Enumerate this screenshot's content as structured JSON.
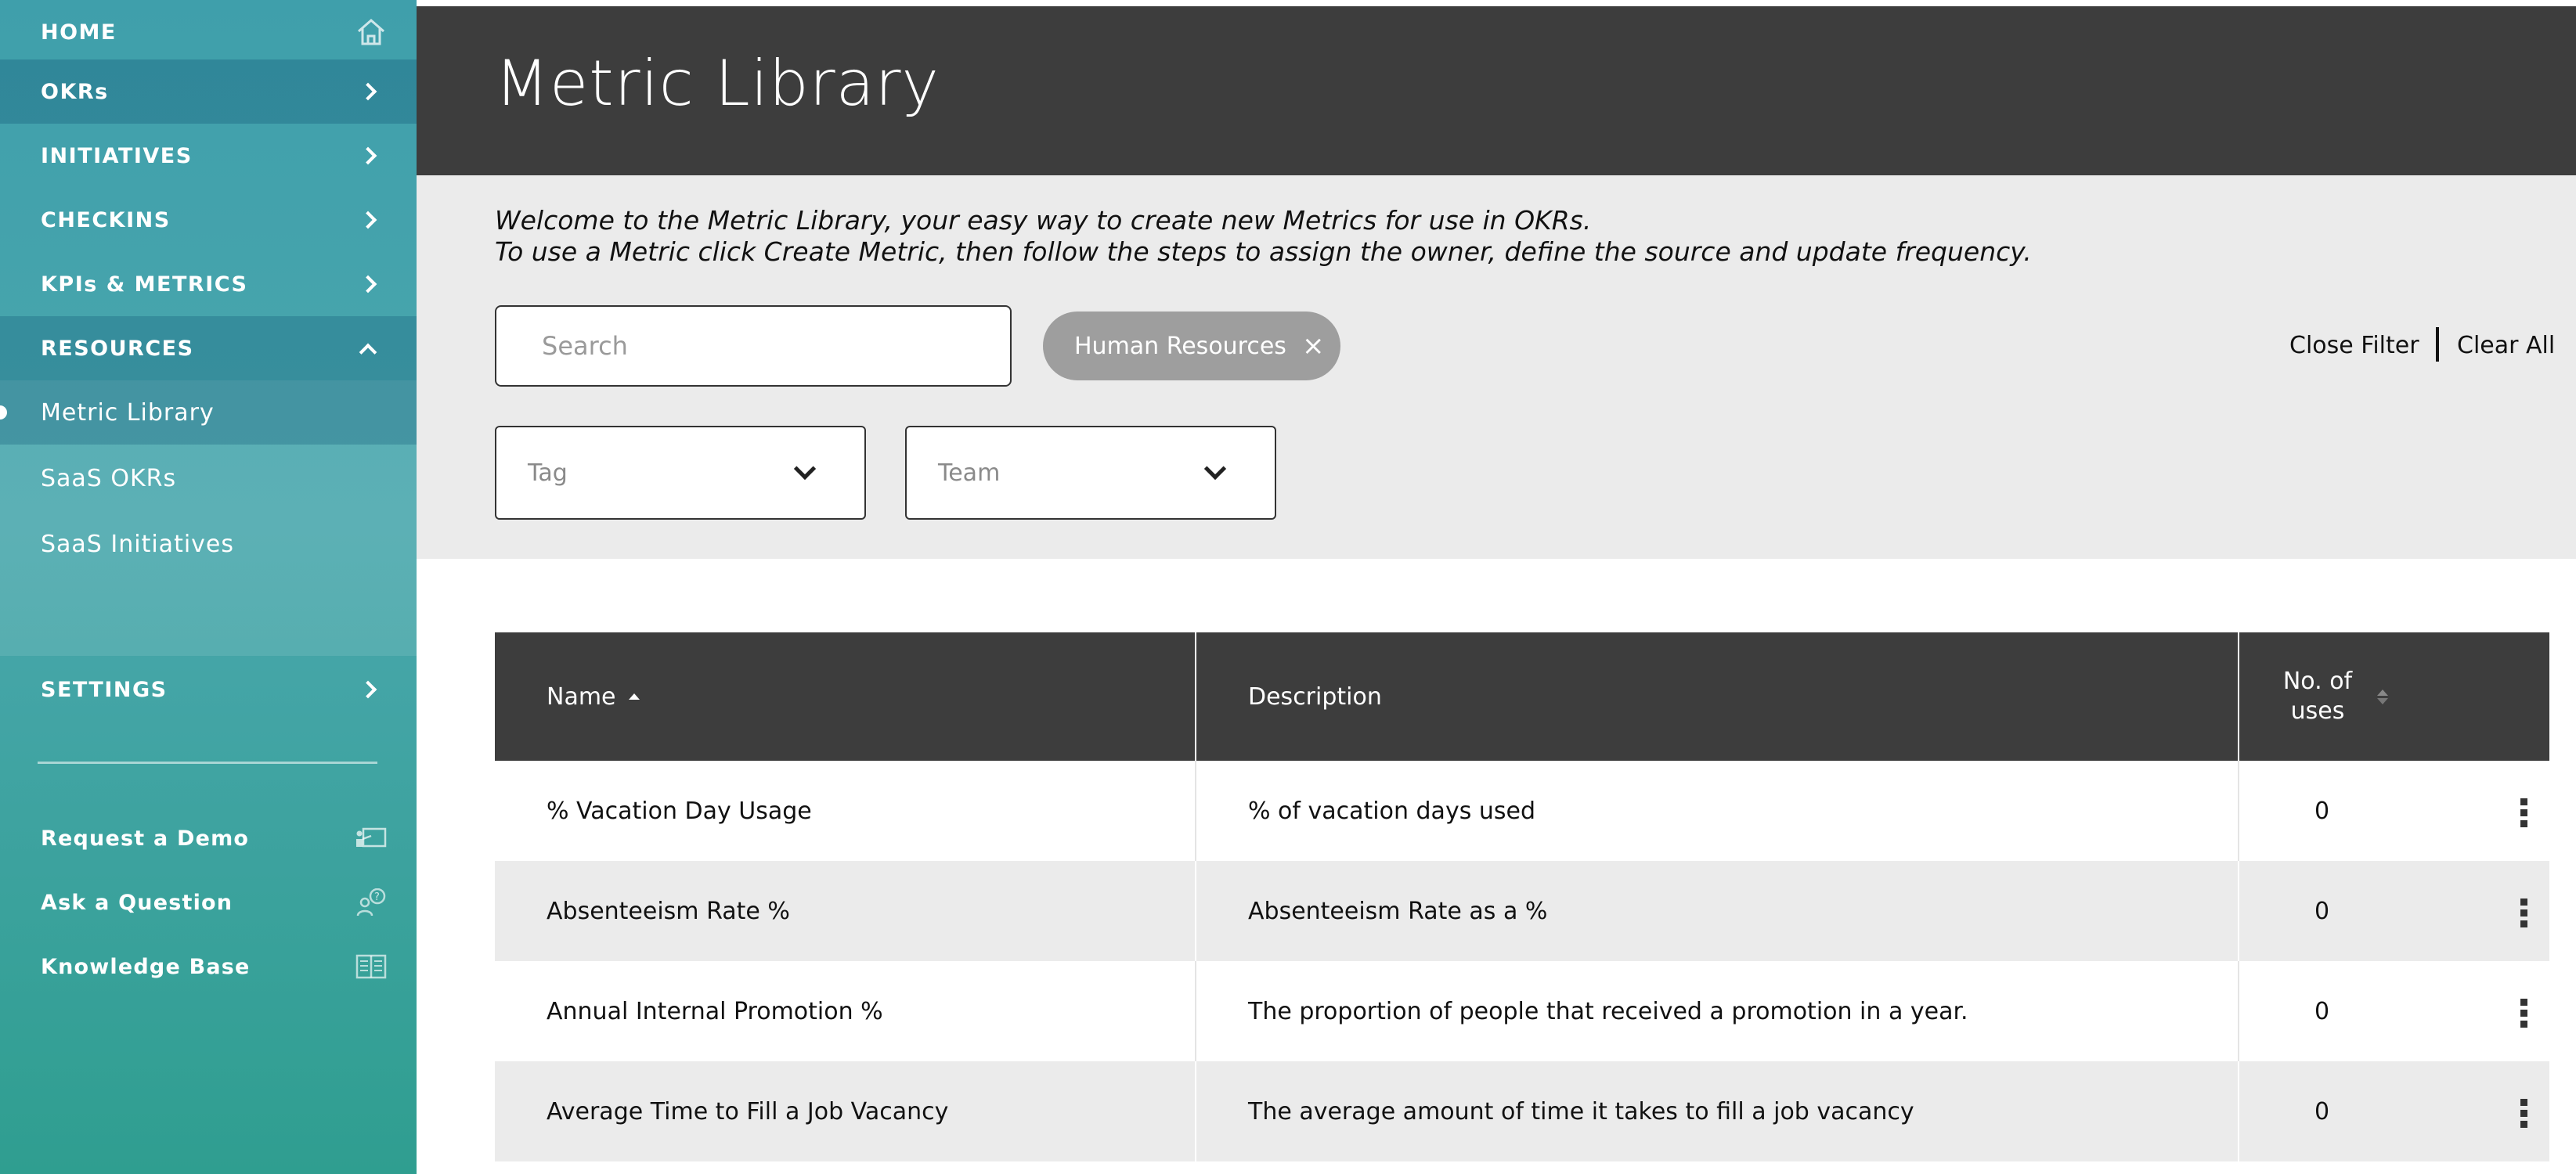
{
  "sidebar": {
    "nav": [
      {
        "label": "HOME",
        "icon": "home-icon"
      },
      {
        "label": "OKRs",
        "icon": "chevron-right-icon"
      },
      {
        "label": "INITIATIVES",
        "icon": "chevron-right-icon"
      },
      {
        "label": "CHECKINS",
        "icon": "chevron-right-icon"
      },
      {
        "label": "KPIs & METRICS",
        "icon": "chevron-right-icon"
      },
      {
        "label": "RESOURCES",
        "icon": "chevron-up-icon"
      }
    ],
    "resources_sub": [
      {
        "label": "Metric Library"
      },
      {
        "label": "SaaS OKRs"
      },
      {
        "label": "SaaS Initiatives"
      }
    ],
    "settings": {
      "label": "SETTINGS",
      "icon": "chevron-right-icon"
    },
    "help": [
      {
        "label": "Request a Demo",
        "icon": "demo-icon"
      },
      {
        "label": "Ask a Question",
        "icon": "question-person-icon"
      },
      {
        "label": "Knowledge Base",
        "icon": "book-icon"
      }
    ]
  },
  "header": {
    "title": "Metric Library"
  },
  "intro": {
    "line1": "Welcome to the Metric Library, your easy way to create new Metrics for use in OKRs.",
    "line2": "To use a Metric click Create Metric, then follow the steps to assign the owner, define the source and update frequency."
  },
  "filters": {
    "search_placeholder": "Search",
    "chip_label": "Human Resources",
    "chip_close": "×",
    "close_filter": "Close Filter",
    "clear_all": "Clear All",
    "tag_label": "Tag",
    "team_label": "Team"
  },
  "table": {
    "headers": {
      "name": "Name",
      "description": "Description",
      "uses_line1": "No. of",
      "uses_line2": "uses"
    },
    "rows": [
      {
        "name": "% Vacation Day Usage",
        "description": "% of vacation days used",
        "uses": "0"
      },
      {
        "name": "Absenteeism Rate %",
        "description": "Absenteeism Rate as a %",
        "uses": "0"
      },
      {
        "name": "Annual Internal Promotion %",
        "description": "The proportion of people that received a promotion in a year.",
        "uses": "0"
      },
      {
        "name": "Average Time to Fill a Job Vacancy",
        "description": "The average amount of time it takes to fill a job vacancy",
        "uses": "0"
      }
    ]
  }
}
